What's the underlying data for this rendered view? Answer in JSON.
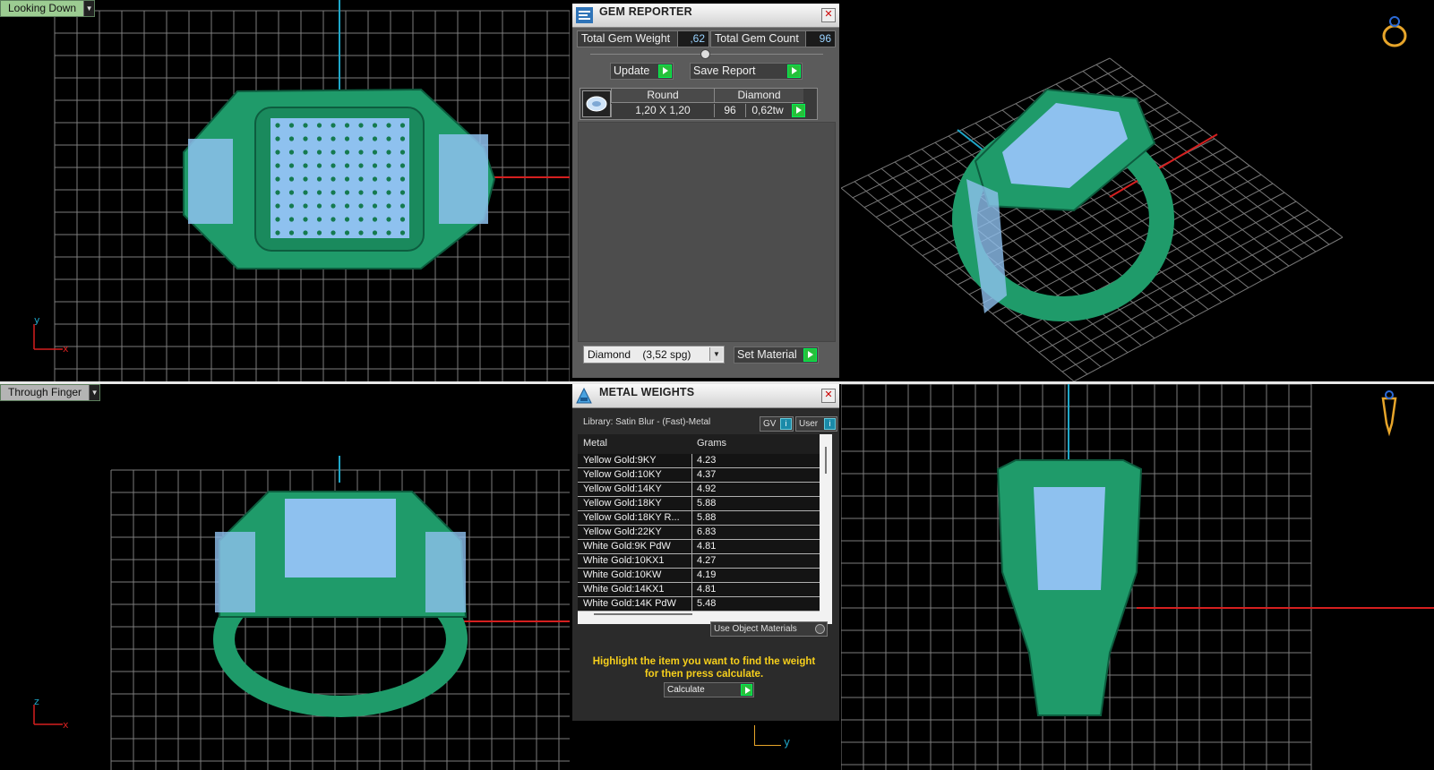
{
  "viewports": {
    "top_left": {
      "view_label": "Looking Down",
      "axis_v": "y",
      "axis_h": "x"
    },
    "bottom_left": {
      "view_label": "Through Finger",
      "axis_v": "z",
      "axis_h": "x"
    },
    "bottom_right": {
      "axis_h": "y"
    }
  },
  "gem_reporter": {
    "title": "GEM REPORTER",
    "total_weight_label": "Total Gem Weight",
    "total_weight_value": ",62",
    "total_count_label": "Total Gem Count",
    "total_count_value": "96",
    "update_label": "Update",
    "save_report_label": "Save Report",
    "gem_table": {
      "headers": [
        "Round",
        "Diamond"
      ],
      "row": {
        "size": "1,20 X 1,20",
        "count": "96",
        "weight": "0,62tw"
      }
    },
    "material_select": "Diamond    (3,52 spg)",
    "set_material_label": "Set Material"
  },
  "metal_weights": {
    "title": "METAL WEIGHTS",
    "library": "Library: Satin Blur - (Fast)-Metal",
    "gv_label": "GV",
    "user_label": "User",
    "columns": [
      "Metal",
      "Grams"
    ],
    "rows": [
      {
        "metal": "Yellow Gold:9KY",
        "grams": "4.23"
      },
      {
        "metal": "Yellow Gold:10KY",
        "grams": "4.37"
      },
      {
        "metal": "Yellow Gold:14KY",
        "grams": "4.92"
      },
      {
        "metal": "Yellow Gold:18KY",
        "grams": "5.88"
      },
      {
        "metal": "Yellow Gold:18KY R...",
        "grams": "5.88"
      },
      {
        "metal": "Yellow Gold:22KY",
        "grams": "6.83"
      },
      {
        "metal": "White Gold:9K PdW",
        "grams": "4.81"
      },
      {
        "metal": "White Gold:10KX1",
        "grams": "4.27"
      },
      {
        "metal": "White Gold:10KW",
        "grams": "4.19"
      },
      {
        "metal": "White Gold:14KX1",
        "grams": "4.81"
      },
      {
        "metal": "White Gold:14K PdW",
        "grams": "5.48"
      }
    ],
    "use_object_materials": "Use Object Materials",
    "hint": "Highlight the item you want to find the weight for then press calculate.",
    "calculate_label": "Calculate"
  },
  "colors": {
    "ring_green": "#1f9b6a",
    "gem_blue": "#9cc6f2",
    "grid": "#7d7d7d",
    "axis_red": "#d51f1f",
    "axis_cyan": "#1fa7c9",
    "accent_green": "#26c13a",
    "hint_yellow": "#f6cf1c"
  }
}
